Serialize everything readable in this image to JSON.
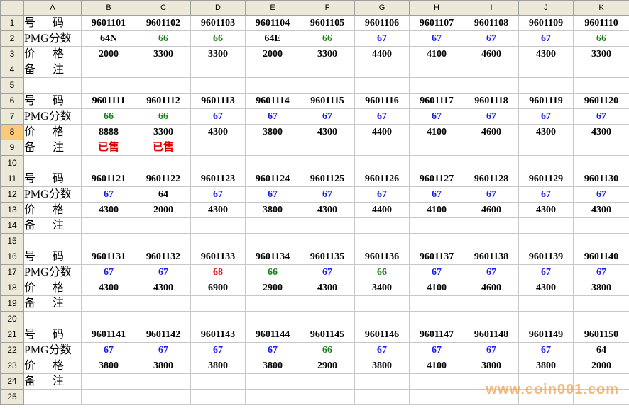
{
  "columns": [
    "A",
    "B",
    "C",
    "D",
    "E",
    "F",
    "G",
    "H",
    "I",
    "J",
    "K"
  ],
  "labels": {
    "number": "号 码",
    "grade": "PMG分数",
    "price": "价 格",
    "note": "备 注"
  },
  "colors": {
    "green": "#1a7f1a",
    "blue": "#1a1aee",
    "red": "#e00000",
    "black": "#000000"
  },
  "blocks": [
    {
      "numbers": [
        "9601101",
        "9601102",
        "9601103",
        "9601104",
        "9601105",
        "9601106",
        "9601107",
        "9601108",
        "9601109",
        "9601110"
      ],
      "grades": [
        "64N",
        "66",
        "66",
        "64E",
        "66",
        "67",
        "67",
        "67",
        "67",
        "66"
      ],
      "grade_colors": [
        "black",
        "green",
        "green",
        "black",
        "green",
        "blue",
        "blue",
        "blue",
        "blue",
        "green"
      ],
      "prices": [
        "2000",
        "3300",
        "3300",
        "2000",
        "3300",
        "4400",
        "4100",
        "4600",
        "4300",
        "3300"
      ],
      "notes": [
        "",
        "",
        "",
        "",
        "",
        "",
        "",
        "",
        "",
        ""
      ]
    },
    {
      "numbers": [
        "9601111",
        "9601112",
        "9601113",
        "9601114",
        "9601115",
        "9601116",
        "9601117",
        "9601118",
        "9601119",
        "9601120"
      ],
      "grades": [
        "66",
        "66",
        "67",
        "67",
        "67",
        "67",
        "67",
        "67",
        "67",
        "67"
      ],
      "grade_colors": [
        "green",
        "green",
        "blue",
        "blue",
        "blue",
        "blue",
        "blue",
        "blue",
        "blue",
        "blue"
      ],
      "prices": [
        "8888",
        "3300",
        "4300",
        "3800",
        "4300",
        "4400",
        "4100",
        "4600",
        "4300",
        "4300"
      ],
      "notes": [
        "已售",
        "已售",
        "",
        "",
        "",
        "",
        "",
        "",
        "",
        ""
      ]
    },
    {
      "numbers": [
        "9601121",
        "9601122",
        "9601123",
        "9601124",
        "9601125",
        "9601126",
        "9601127",
        "9601128",
        "9601129",
        "9601130"
      ],
      "grades": [
        "67",
        "64",
        "67",
        "67",
        "67",
        "67",
        "67",
        "67",
        "67",
        "67"
      ],
      "grade_colors": [
        "blue",
        "black",
        "blue",
        "blue",
        "blue",
        "blue",
        "blue",
        "blue",
        "blue",
        "blue"
      ],
      "prices": [
        "4300",
        "2000",
        "4300",
        "3800",
        "4300",
        "4400",
        "4100",
        "4600",
        "4300",
        "4300"
      ],
      "notes": [
        "",
        "",
        "",
        "",
        "",
        "",
        "",
        "",
        "",
        ""
      ]
    },
    {
      "numbers": [
        "9601131",
        "9601132",
        "9601133",
        "9601134",
        "9601135",
        "9601136",
        "9601137",
        "9601138",
        "9601139",
        "9601140"
      ],
      "grades": [
        "67",
        "67",
        "68",
        "66",
        "67",
        "66",
        "67",
        "67",
        "67",
        "67"
      ],
      "grade_colors": [
        "blue",
        "blue",
        "red",
        "green",
        "blue",
        "green",
        "blue",
        "blue",
        "blue",
        "blue"
      ],
      "prices": [
        "4300",
        "4300",
        "6900",
        "2900",
        "4300",
        "3400",
        "4100",
        "4600",
        "4300",
        "3800"
      ],
      "notes": [
        "",
        "",
        "",
        "",
        "",
        "",
        "",
        "",
        "",
        ""
      ]
    },
    {
      "numbers": [
        "9601141",
        "9601142",
        "9601143",
        "9601144",
        "9601145",
        "9601146",
        "9601147",
        "9601148",
        "9601149",
        "9601150"
      ],
      "grades": [
        "67",
        "67",
        "67",
        "67",
        "66",
        "67",
        "67",
        "67",
        "67",
        "64"
      ],
      "grade_colors": [
        "blue",
        "blue",
        "blue",
        "blue",
        "green",
        "blue",
        "blue",
        "blue",
        "blue",
        "black"
      ],
      "prices": [
        "3800",
        "3800",
        "3800",
        "3800",
        "2900",
        "3800",
        "4100",
        "3800",
        "3800",
        "2000"
      ],
      "notes": [
        "",
        "",
        "",
        "",
        "",
        "",
        "",
        "",
        "",
        ""
      ]
    }
  ],
  "total_rows": 25,
  "selected_row": 8,
  "watermark": "www.coin001.com"
}
